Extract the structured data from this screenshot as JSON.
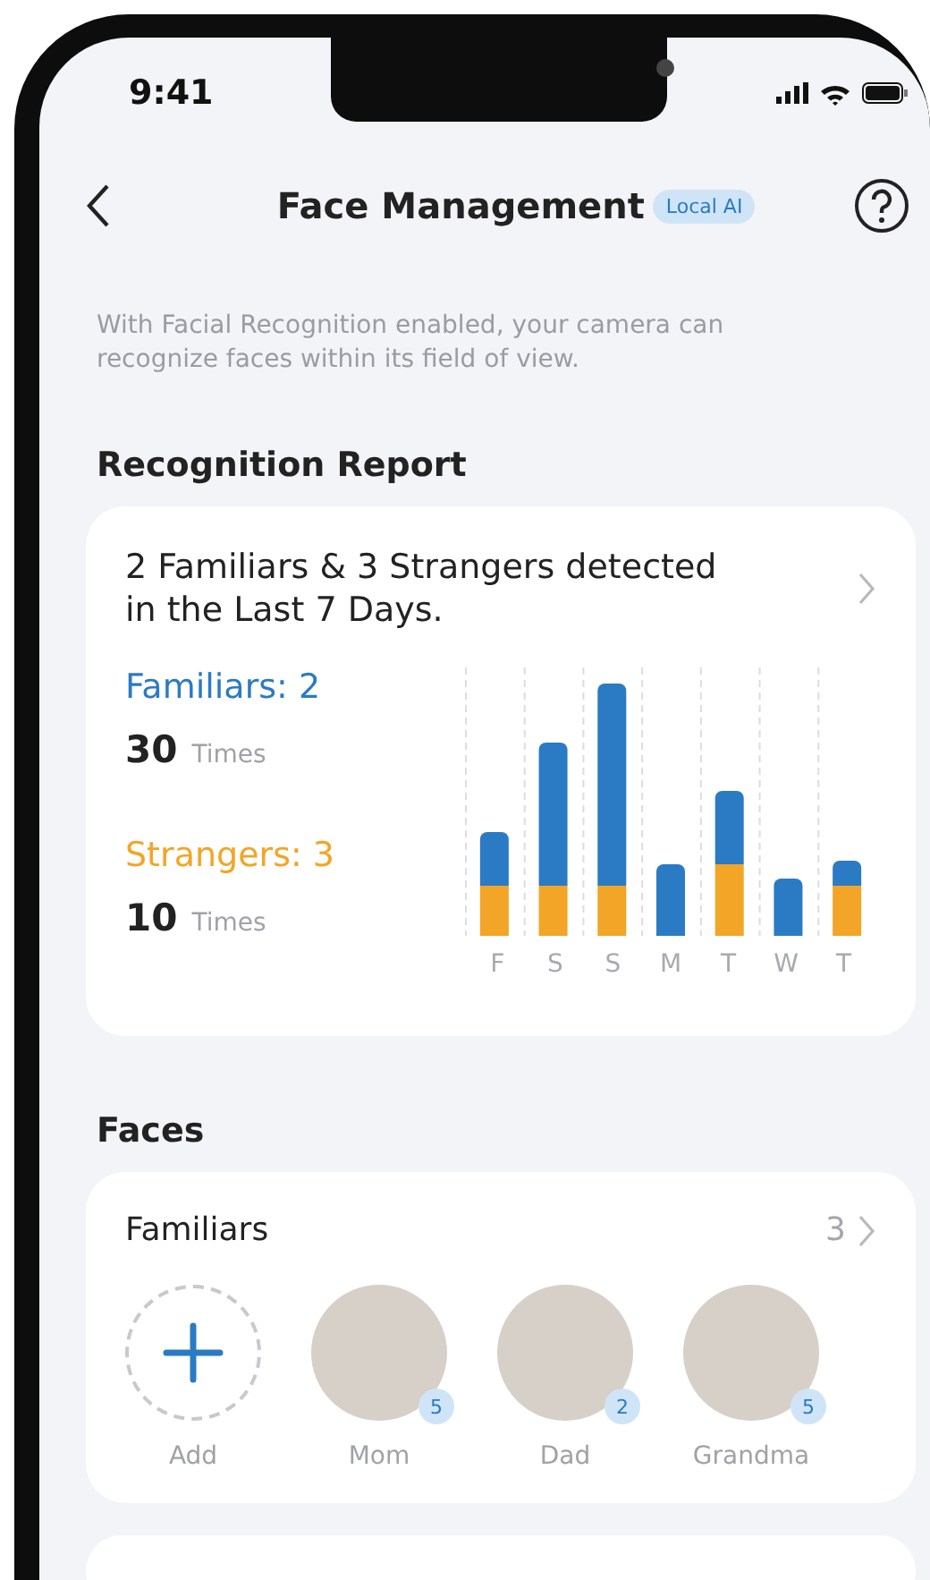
{
  "status_bar": {
    "time": "9:41"
  },
  "header": {
    "title": "Face Management",
    "badge": "Local AI"
  },
  "description": "With Facial Recognition enabled, your camera can recognize faces within its field of view.",
  "report": {
    "heading": "Recognition Report",
    "summary": "2 Familiars & 3 Strangers detected in the Last 7 Days.",
    "groups": [
      {
        "kind": "familiar",
        "label": "Familiars: 2",
        "count": "30",
        "unit": "Times"
      },
      {
        "kind": "stranger",
        "label": "Strangers: 3",
        "count": "10",
        "unit": "Times"
      }
    ],
    "days": [
      "F",
      "S",
      "S",
      "M",
      "T",
      "W",
      "T"
    ]
  },
  "faces": {
    "heading": "Faces",
    "card_title": "Familiars",
    "count": "3",
    "add_label": "Add",
    "people": [
      {
        "name": "Mom",
        "badge": "5"
      },
      {
        "name": "Dad",
        "badge": "2"
      },
      {
        "name": "Grandma",
        "badge": "5"
      }
    ]
  }
}
